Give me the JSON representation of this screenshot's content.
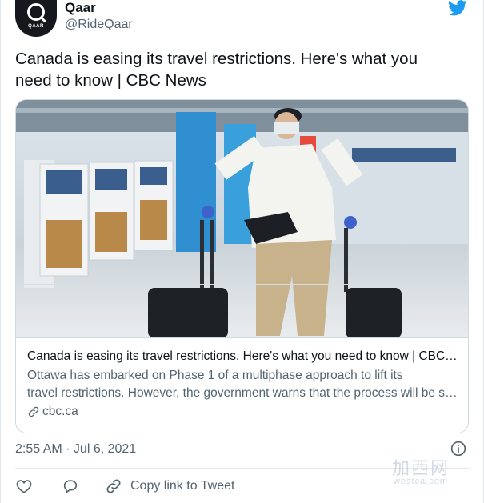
{
  "account": {
    "display_name": "Qaar",
    "handle": "@RideQaar",
    "avatar_logo_text": "QAAR"
  },
  "tweet": {
    "text_line1": "Canada is easing its travel restrictions. Here's what you",
    "text_line2": "need to know | CBC News",
    "timestamp": "2:55 AM · Jul 6, 2021"
  },
  "card": {
    "image_alt": "Traveller in mask wheeling suitcases through airport terminal",
    "title": "Canada is easing its travel restrictions. Here's what you need to know | CBC News",
    "desc_line1": "Ottawa has embarked on Phase 1 of a multiphase approach to lift its",
    "desc_line2": "travel restrictions. However, the government warns that the process will be slow.",
    "domain": "cbc.ca"
  },
  "actions": {
    "copy_link_label": "Copy link to Tweet"
  },
  "watermark": {
    "cn": "加西网",
    "en": "westca.com"
  },
  "icons": {
    "brand": "twitter-bird-icon",
    "info": "info-icon",
    "like": "heart-icon",
    "reply": "reply-bubble-icon",
    "link": "link-icon"
  },
  "colors": {
    "twitter_blue": "#1d9bf0",
    "text_primary": "#0f1419",
    "text_secondary": "#536471",
    "border": "#cfd9de"
  }
}
